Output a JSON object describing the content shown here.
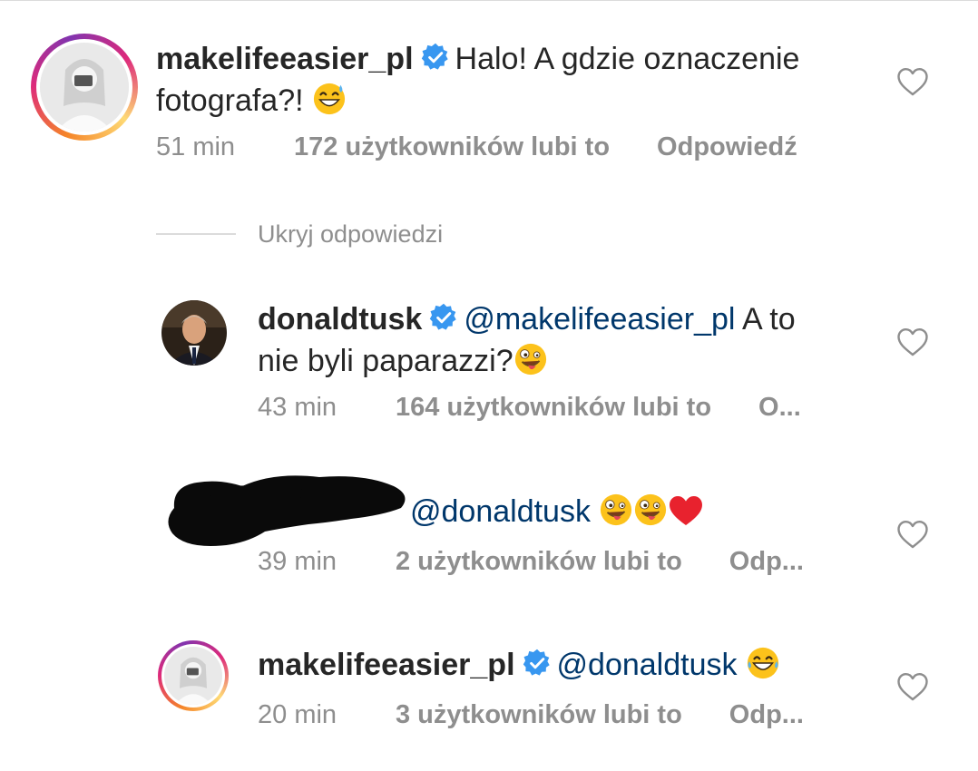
{
  "comments": [
    {
      "username": "makelifeeasier_pl",
      "text_line1": "Halo! A gdzie oznaczenie",
      "text_line2": "fotografa?! ",
      "time": "51 min",
      "likes": "172 użytkowników lubi to",
      "reply": "Odpowiedź",
      "emoji_icon": "grinning-sweat-emoji"
    },
    {
      "username": "donaldtusk",
      "mention": "@makelifeeasier_pl",
      "text_line1_rest": " A to",
      "text_line2": "nie byli paparazzi?",
      "time": "43 min",
      "likes": "164 użytkowników lubi to",
      "reply": "O...",
      "emoji_icon": "zany-face-emoji"
    },
    {
      "username": "",
      "mention": "@donaldtusk",
      "time": "39 min",
      "likes": "2 użytkowników lubi to",
      "reply": "Odp...",
      "emoji_icons": [
        "zany-face-emoji",
        "zany-face-emoji",
        "red-heart-emoji"
      ]
    },
    {
      "username": "makelifeeasier_pl",
      "mention": "@donaldtusk",
      "time": "20 min",
      "likes": "3 użytkowników lubi to",
      "reply": "Odp...",
      "emoji_icon": "laughing-tears-emoji"
    }
  ],
  "hide_replies": "Ukryj odpowiedzi",
  "colors": {
    "text": "#262626",
    "meta": "#8e8e8e",
    "mention": "#00376b",
    "verified": "#3897f0",
    "divider": "#dbdbdb"
  }
}
